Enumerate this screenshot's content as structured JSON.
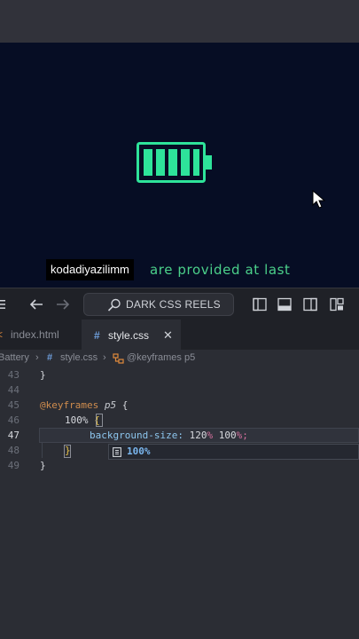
{
  "preview": {
    "caption_name": "kodadiyazilimm",
    "caption_text": "are provided at last",
    "colors": {
      "background": "#060d24",
      "battery": "#2ee39a"
    }
  },
  "titlebar": {
    "search_label": "DARK CSS REELS"
  },
  "tabs": [
    {
      "icon": "html-file-icon",
      "label": "index.html"
    },
    {
      "icon": "css-hash-icon",
      "label": "style.css",
      "close": "✕"
    }
  ],
  "breadcrumb": {
    "folder": "Battery",
    "file": "style.css",
    "symbol": "@keyframes p5"
  },
  "editor": {
    "line_numbers": [
      "43",
      "44",
      "45",
      "46",
      "47",
      "48",
      "49"
    ],
    "lines": {
      "l43": "}",
      "l45_kw": "@keyframes",
      "l45_name": "p5",
      "l45_brace": "{",
      "l46_pct": "100%",
      "l46_brace": "{",
      "l47_prop": "background-size:",
      "l47_v1": "120",
      "l47_u1": "%",
      "l47_v2": "100",
      "l47_u2": "%;",
      "l48_brace": "}",
      "l49": "}"
    },
    "suggestion": "100%"
  }
}
